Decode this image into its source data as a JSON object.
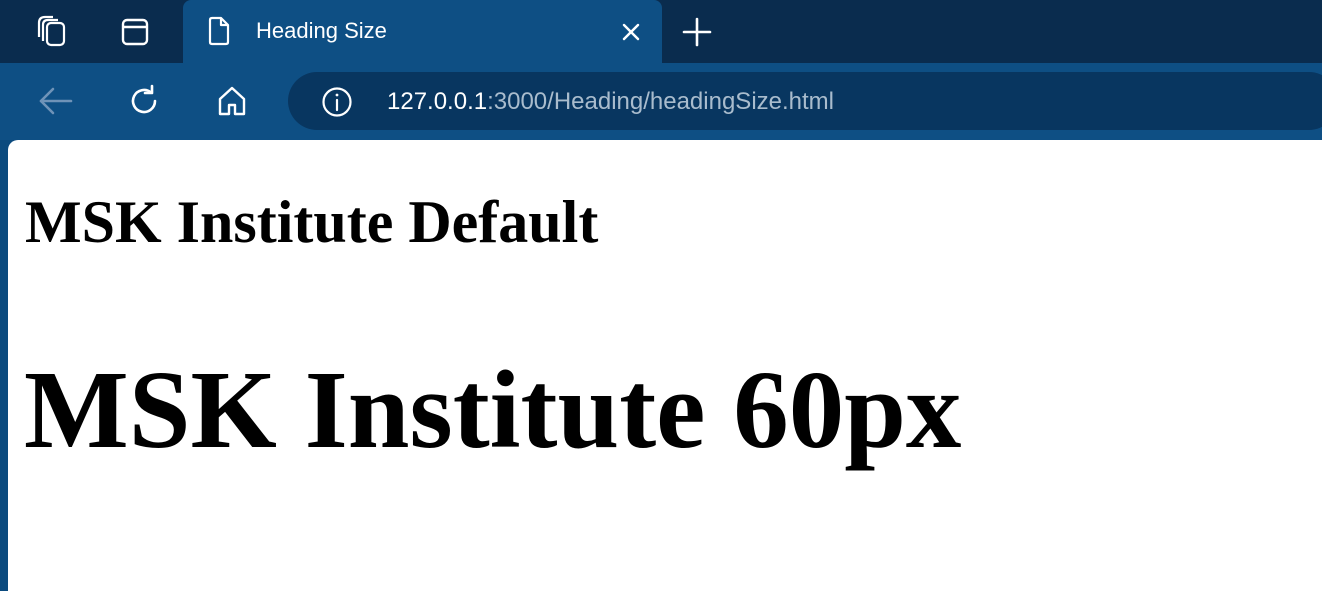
{
  "browser": {
    "tab": {
      "title": "Heading Size",
      "close_icon": "close-icon",
      "favicon": "document-icon"
    },
    "strip_icons": [
      "workspaces-icon",
      "tab-actions-icon"
    ],
    "new_tab_icon": "plus-icon",
    "toolbar": {
      "back_icon": "back-arrow-icon",
      "reload_icon": "reload-icon",
      "home_icon": "home-icon",
      "info_icon": "info-icon"
    },
    "address": {
      "host": "127.0.0.1",
      "rest": ":3000/Heading/headingSize.html"
    },
    "colors": {
      "tab_strip": "#0a2c4e",
      "toolbar": "#0e4f84",
      "address_bar": "#083660",
      "url_host": "#ffffff",
      "url_rest": "#a9bccd"
    }
  },
  "page": {
    "heading_default": "MSK Institute Default",
    "heading_60px": "MSK Institute 60px"
  }
}
